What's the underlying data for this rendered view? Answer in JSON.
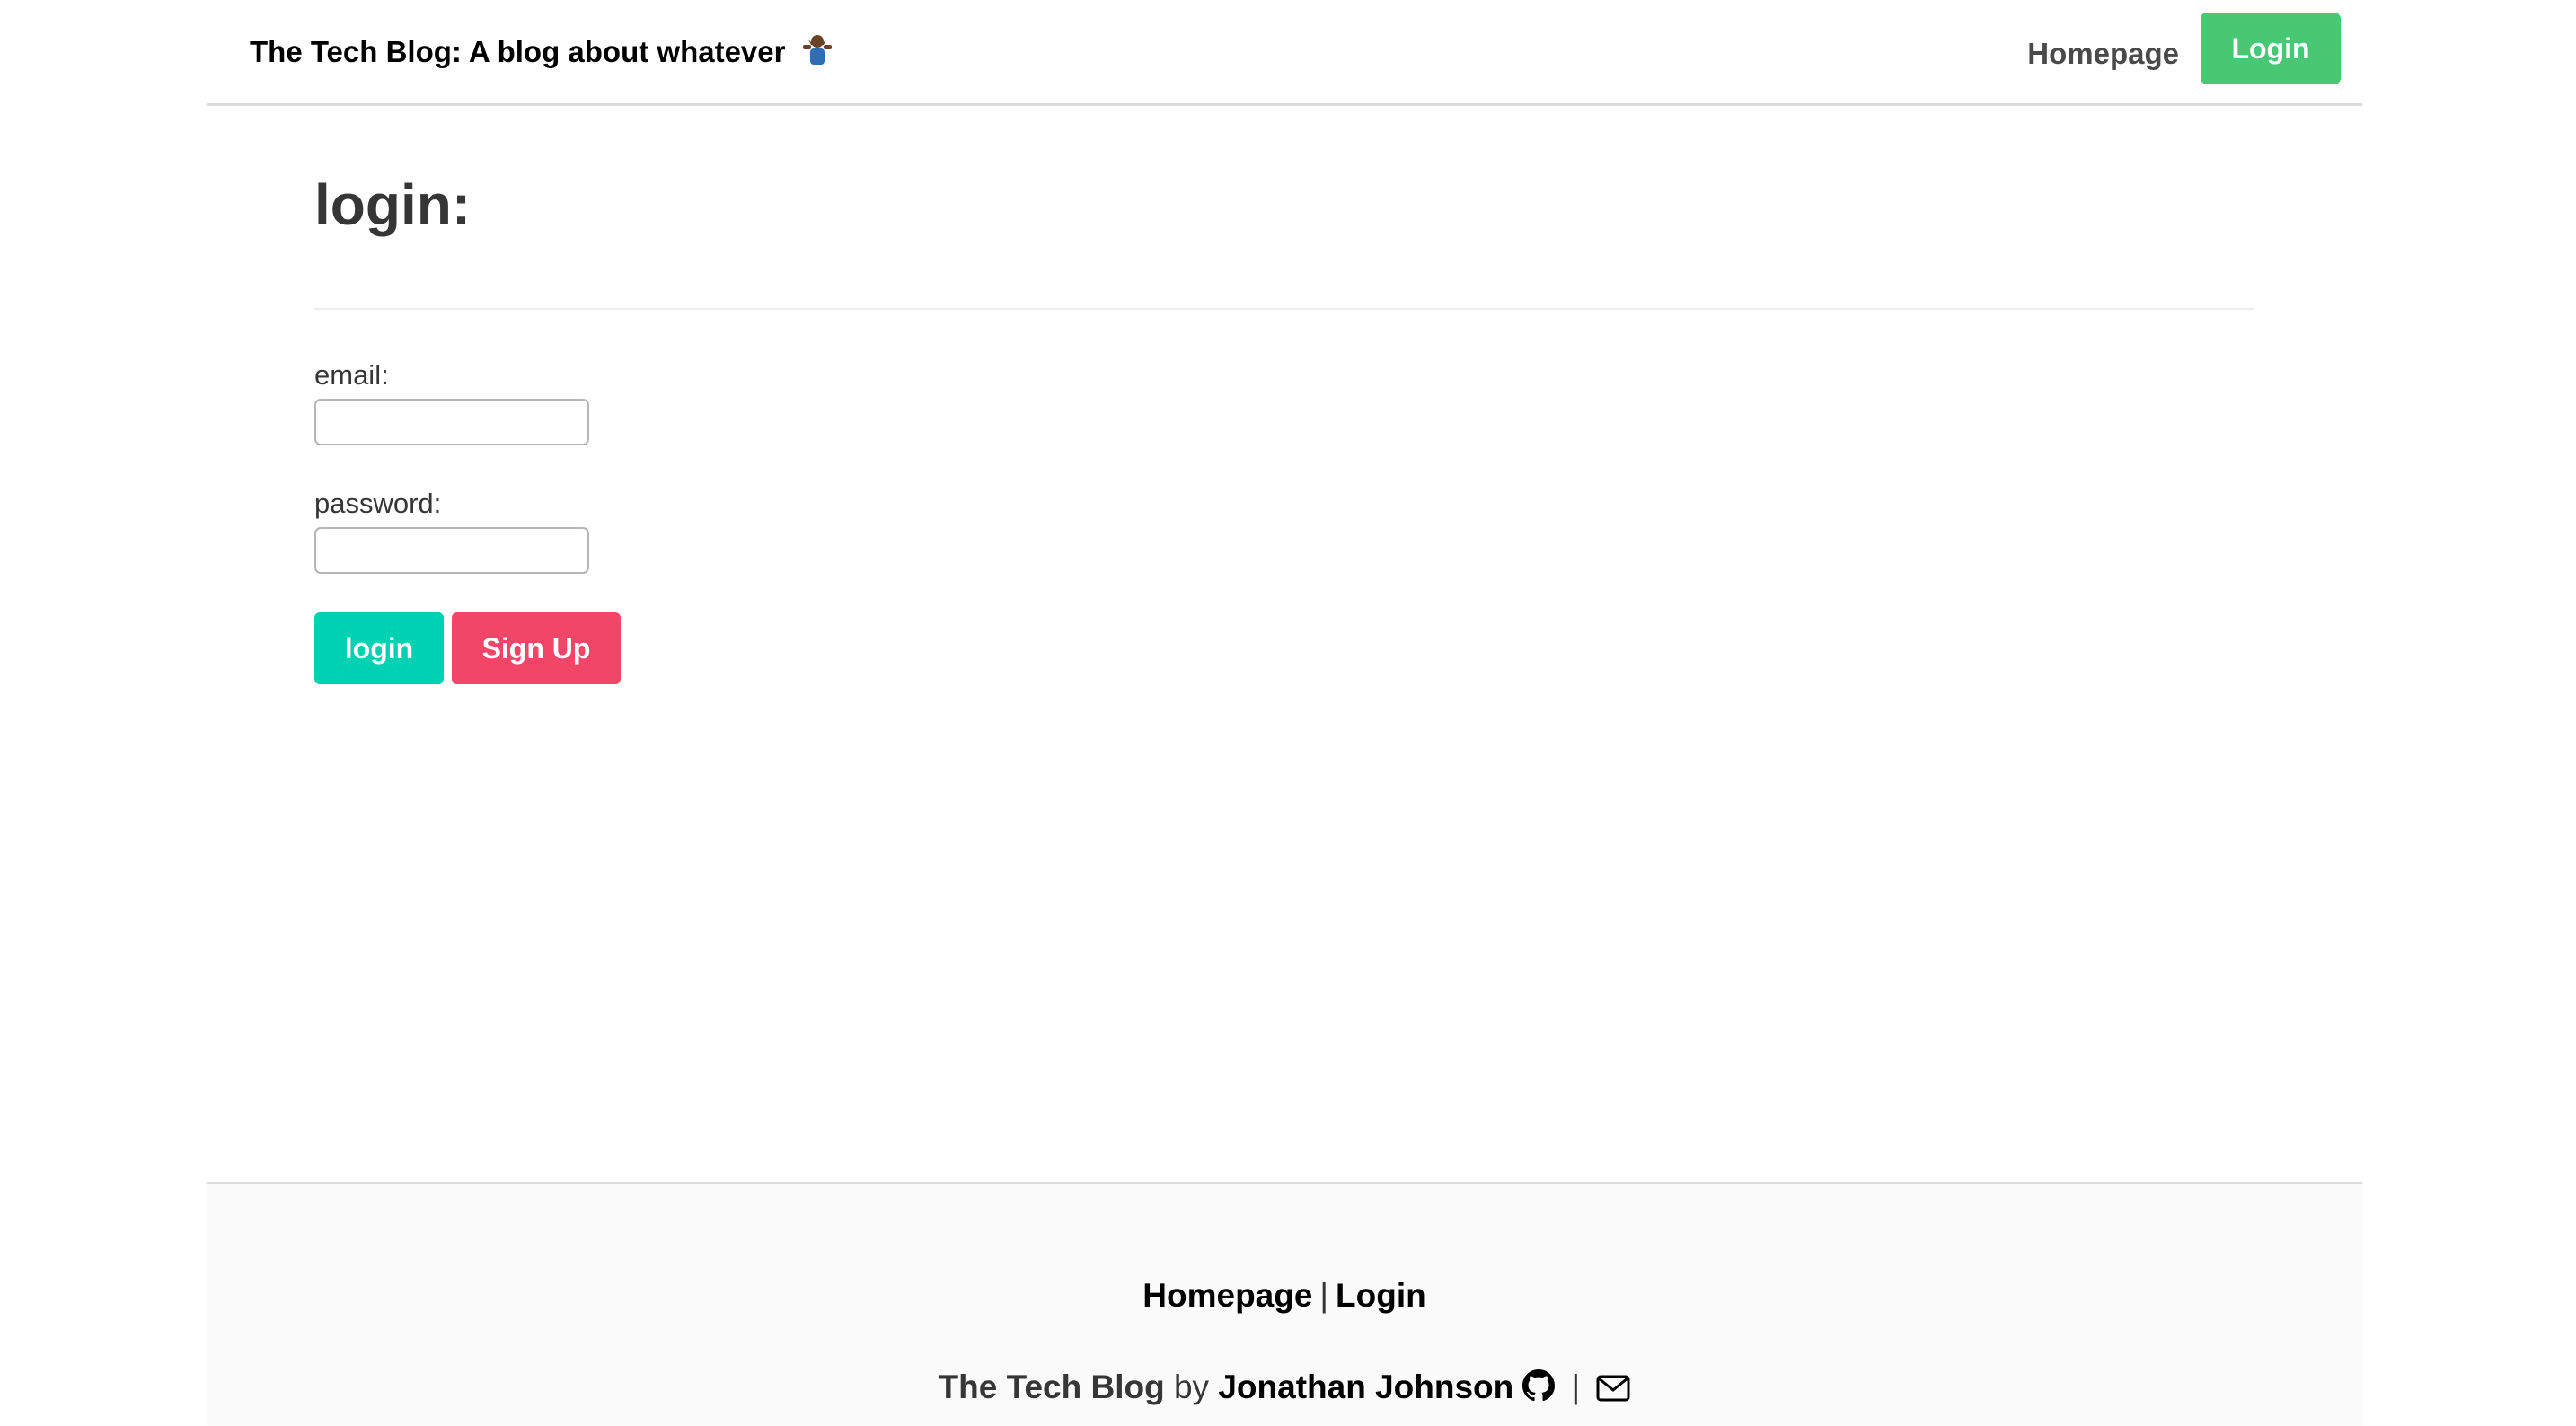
{
  "navbar": {
    "brand": "The Tech Blog: A blog about whatever",
    "brand_emoji": "🤷🏾‍♂️",
    "homepage_label": "Homepage",
    "login_label": "Login"
  },
  "main": {
    "title": "login:",
    "email_label": "email:",
    "email_value": "",
    "password_label": "password:",
    "password_value": "",
    "login_button": "login",
    "signup_button": "Sign Up"
  },
  "footer": {
    "homepage_link": "Homepage",
    "separator": "|",
    "login_link": "Login",
    "site_name": "The Tech Blog",
    "by_text": "by",
    "author": "Jonathan Johnson",
    "icons": [
      "github-icon",
      "envelope-icon"
    ]
  },
  "colors": {
    "login_green": "#48c774",
    "primary_teal": "#00d1b2",
    "danger_pink": "#f14668"
  }
}
